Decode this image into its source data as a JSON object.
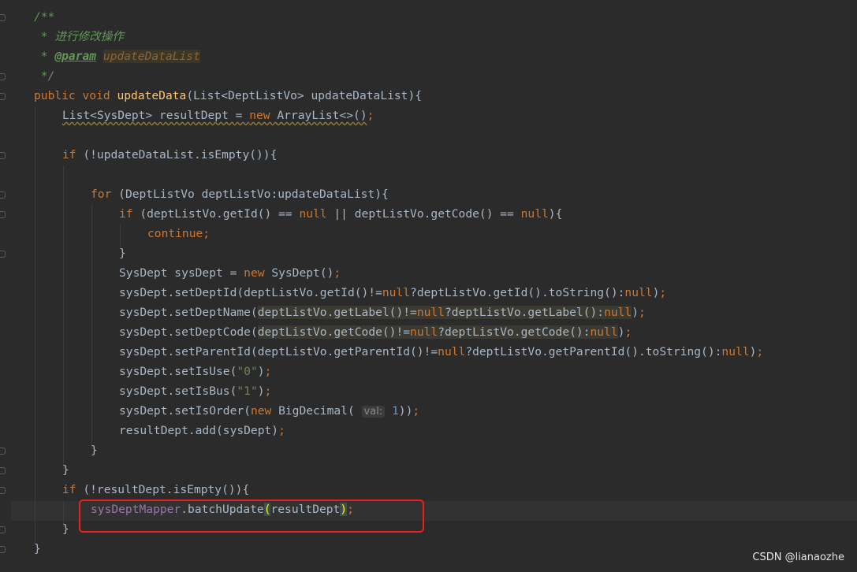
{
  "code": {
    "l1": "/**",
    "l2": " * 进行修改操作",
    "l3_star": " * ",
    "l3_tag": "@param",
    "l3_param": "updateDataList",
    "l4": " */",
    "l5_public": "public void ",
    "l5_name": "updateData",
    "l5_rest": "(List<DeptListVo> updateDataList){",
    "l6_a": "List<SysDept> resultDept = ",
    "l6_new": "new ",
    "l6_b": "ArrayList<>()",
    "l6_semi": ";",
    "l8_if": "if ",
    "l8_rest": "(!updateDataList.isEmpty()){",
    "l10_for": "for ",
    "l10_rest": "(DeptListVo deptListVo:updateDataList){",
    "l11_if": "if ",
    "l11_a": "(deptListVo.getId() == ",
    "l11_null1": "null",
    "l11_b": " || deptListVo.getCode() == ",
    "l11_null2": "null",
    "l11_c": "){",
    "l12": "continue;",
    "l13": "}",
    "l14_a": "SysDept sysDept = ",
    "l14_new": "new ",
    "l14_b": "SysDept()",
    "l14_semi": ";",
    "l15_a": "sysDept.setDeptId(deptListVo.getId()!=",
    "l15_null1": "null",
    "l15_b": "?deptListVo.getId().toString():",
    "l15_null2": "null",
    "l15_c": ")",
    "l15_semi": ";",
    "l16_a": "sysDept.setDeptName(",
    "l16_b": "deptListVo.getLabel()!=",
    "l16_null1": "null",
    "l16_c": "?deptListVo.getLabel():",
    "l16_null2": "null",
    "l16_d": ")",
    "l16_semi": ";",
    "l17_a": "sysDept.setDeptCode(",
    "l17_b": "deptListVo.getCode()!=",
    "l17_null1": "null",
    "l17_c": "?deptListVo.getCode():",
    "l17_null2": "null",
    "l17_d": ")",
    "l17_semi": ";",
    "l18_a": "sysDept.setParentId(deptListVo.getParentId()!=",
    "l18_null1": "null",
    "l18_b": "?deptListVo.getParentId().toString():",
    "l18_null2": "null",
    "l18_c": ")",
    "l18_semi": ";",
    "l19_a": "sysDept.setIsUse(",
    "l19_str": "\"0\"",
    "l19_b": ")",
    "l19_semi": ";",
    "l20_a": "sysDept.setIsBus(",
    "l20_str": "\"1\"",
    "l20_b": ")",
    "l20_semi": ";",
    "l21_a": "sysDept.setIsOrder(",
    "l21_new": "new ",
    "l21_b": "BigDecimal( ",
    "l21_hint": "val:",
    "l21_num": "1",
    "l21_c": "))",
    "l21_semi": ";",
    "l22_a": "resultDept.add(sysDept)",
    "l22_semi": ";",
    "l23": "}",
    "l24": "}",
    "l25_if": "if ",
    "l25_rest": "(!resultDept.isEmpty()){",
    "l26_field": "sysDeptMapper",
    "l26_dot": ".",
    "l26_call": "batchUpdate",
    "l26_open": "(",
    "l26_arg": "resultDept",
    "l26_close": ")",
    "l26_semi": ";",
    "l27": "}",
    "l28": "}"
  },
  "watermark": "CSDN @lianaozhe",
  "colors": {
    "background": "#2b2b2b",
    "keyword": "#cc7832",
    "method_decl": "#ffc66d",
    "string": "#6a8759",
    "number": "#6897bb",
    "field": "#9876aa",
    "doc_comment": "#629755",
    "highlight_box": "#e8211f"
  }
}
